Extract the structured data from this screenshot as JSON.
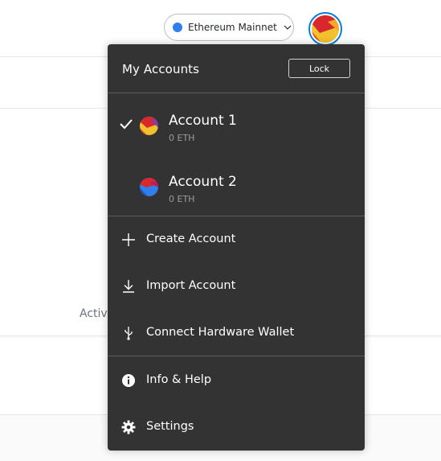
{
  "network": {
    "label": "Ethereum Mainnet",
    "dot_color": "#2f80ed",
    "chevron_icon": "chevron-down-icon"
  },
  "background": {
    "activity_label": "Activ"
  },
  "account_menu": {
    "title": "My Accounts",
    "lock_label": "Lock",
    "accounts": [
      {
        "name": "Account 1",
        "balance": "0 ETH",
        "selected": true,
        "icon": "account-identicon"
      },
      {
        "name": "Account 2",
        "balance": "0 ETH",
        "selected": false,
        "icon": "account-identicon"
      }
    ],
    "actions": [
      {
        "label": "Create Account",
        "icon": "plus-icon"
      },
      {
        "label": "Import Account",
        "icon": "download-icon"
      },
      {
        "label": "Connect Hardware Wallet",
        "icon": "usb-icon"
      }
    ],
    "footer": [
      {
        "label": "Info & Help",
        "icon": "info-icon"
      },
      {
        "label": "Settings",
        "icon": "gear-icon"
      }
    ]
  },
  "colors": {
    "menu_background": "#333333",
    "accent": "#037dd6",
    "muted_text": "#9b9b9b"
  }
}
